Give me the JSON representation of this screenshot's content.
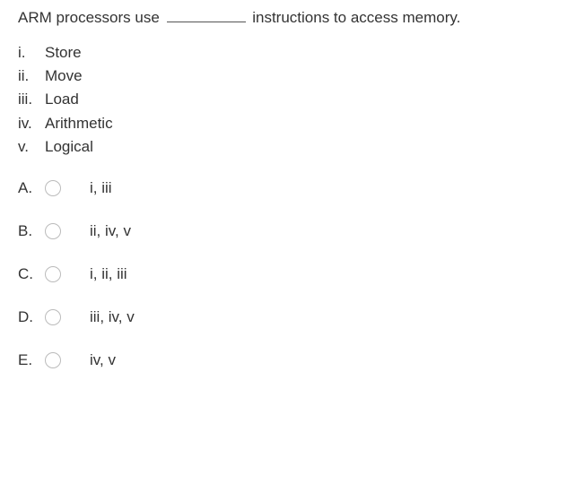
{
  "question": {
    "stem_before": "ARM processors use ",
    "stem_after": " instructions to access memory."
  },
  "roman": [
    {
      "marker": "i.",
      "text": "Store"
    },
    {
      "marker": "ii.",
      "text": "Move"
    },
    {
      "marker": "iii.",
      "text": "Load"
    },
    {
      "marker": "iv.",
      "text": "Arithmetic"
    },
    {
      "marker": "v.",
      "text": "Logical"
    }
  ],
  "options": [
    {
      "letter": "A.",
      "text": "i, iii"
    },
    {
      "letter": "B.",
      "text": "ii, iv, v"
    },
    {
      "letter": "C.",
      "text": "i, ii, iii"
    },
    {
      "letter": "D.",
      "text": "iii, iv, v"
    },
    {
      "letter": "E.",
      "text": "iv, v"
    }
  ]
}
